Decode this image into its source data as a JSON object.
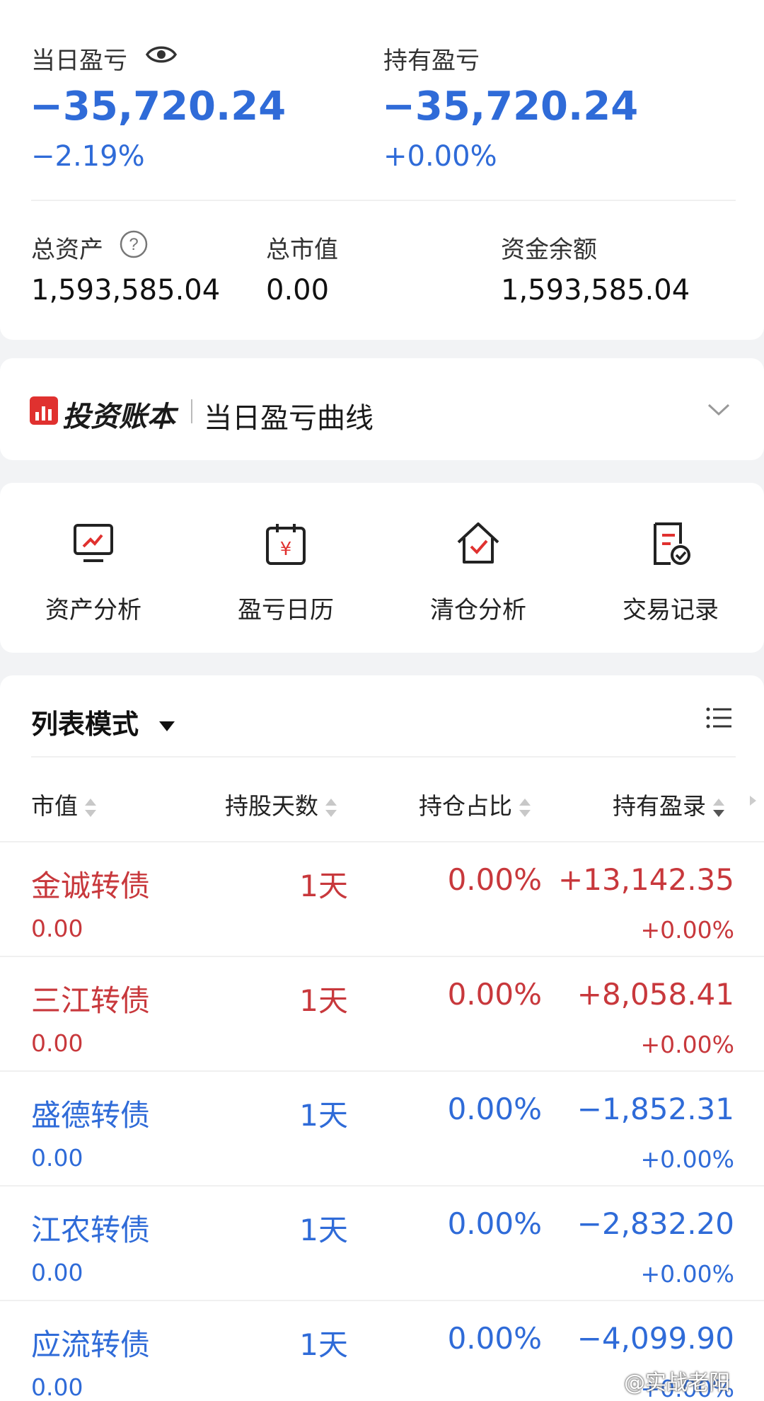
{
  "summary": {
    "daily_label": "当日盈亏",
    "daily_value": "−35,720.24",
    "daily_pct": "−2.19%",
    "holding_label": "持有盈亏",
    "holding_value": "−35,720.24",
    "holding_pct": "+0.00%",
    "total_assets_label": "总资产",
    "total_assets_value": "1,593,585.04",
    "market_value_label": "总市值",
    "market_value_value": "0.00",
    "cash_label": "资金余额",
    "cash_value": "1,593,585.04"
  },
  "banner": {
    "brand": "投资账本",
    "title": "当日盈亏曲线"
  },
  "tools": [
    {
      "label": "资产分析",
      "icon": "monitor-chart-icon"
    },
    {
      "label": "盈亏日历",
      "icon": "calendar-yen-icon"
    },
    {
      "label": "清仓分析",
      "icon": "house-check-icon"
    },
    {
      "label": "交易记录",
      "icon": "document-check-icon"
    }
  ],
  "list": {
    "mode_label": "列表模式",
    "columns": [
      "市值",
      "持股天数",
      "持仓占比",
      "持有盈录"
    ],
    "rows": [
      {
        "name": "金诚转债",
        "market_value": "0.00",
        "days": "1天",
        "ratio": "0.00%",
        "pnl": "+13,142.35",
        "pnl_pct": "+0.00%",
        "tone": "red"
      },
      {
        "name": "三江转债",
        "market_value": "0.00",
        "days": "1天",
        "ratio": "0.00%",
        "pnl": "+8,058.41",
        "pnl_pct": "+0.00%",
        "tone": "red"
      },
      {
        "name": "盛德转债",
        "market_value": "0.00",
        "days": "1天",
        "ratio": "0.00%",
        "pnl": "−1,852.31",
        "pnl_pct": "+0.00%",
        "tone": "blue"
      },
      {
        "name": "江农转债",
        "market_value": "0.00",
        "days": "1天",
        "ratio": "0.00%",
        "pnl": "−2,832.20",
        "pnl_pct": "+0.00%",
        "tone": "blue"
      },
      {
        "name": "应流转债",
        "market_value": "0.00",
        "days": "1天",
        "ratio": "0.00%",
        "pnl": "−4,099.90",
        "pnl_pct": "+0.00%",
        "tone": "blue"
      }
    ]
  },
  "watermark": "@实战老阳",
  "colors": {
    "negative": "#2f6bd8",
    "positive": "#c8383c",
    "brand": "#e0312f"
  }
}
